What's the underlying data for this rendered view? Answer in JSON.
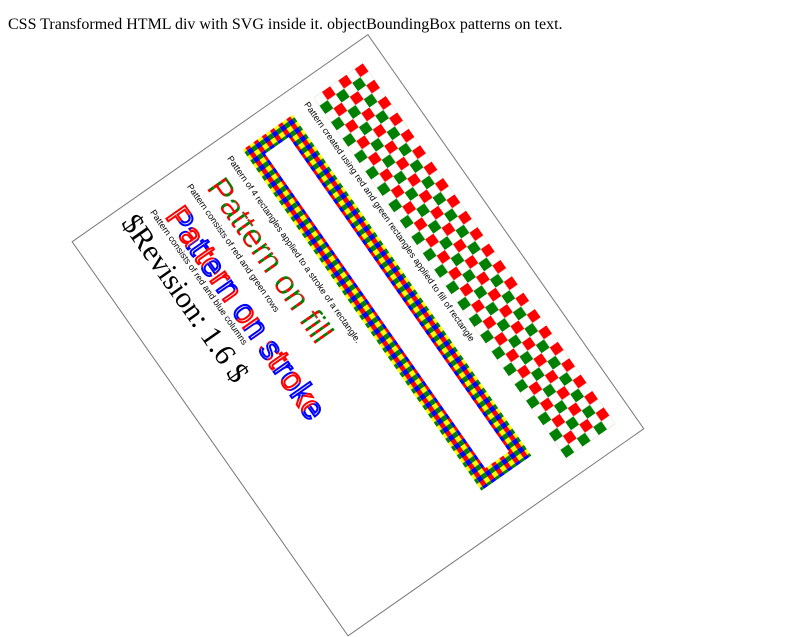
{
  "page": {
    "caption": "CSS Transformed HTML div with SVG inside it. objectBoundingBox patterns on text."
  },
  "svg_test": {
    "labels": {
      "rect_fill_pattern": "Pattern created using red and green rectangles applied to fill of rectangle",
      "rect_stroke_pattern": "Pattern of 4 rectangles applied to a stroke of a rectangle.",
      "text_fill_text": "Pattern on fill",
      "text_fill_desc": "Pattern consists of red and green rows",
      "text_stroke_text": "Pattern on stroke",
      "text_stroke_desc": "Pattern consists of red and blue columns",
      "revision": "$Revision: 1.6 $"
    },
    "colors": {
      "red": "#ff0000",
      "green": "#008000",
      "blue": "#0000ff",
      "yellow": "#ffff00",
      "text": "#000000",
      "border": "#777777"
    }
  }
}
